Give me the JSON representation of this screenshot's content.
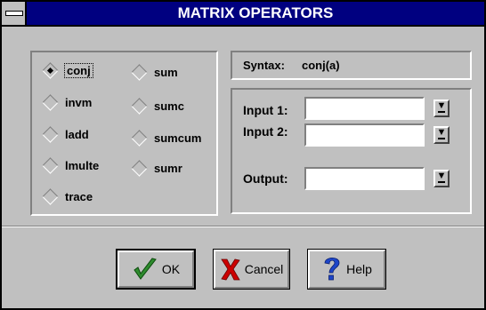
{
  "window": {
    "title": "MATRIX OPERATORS"
  },
  "functions": {
    "selected": "conj",
    "items": [
      {
        "label": "conj",
        "checked": true
      },
      {
        "label": "invm",
        "checked": false
      },
      {
        "label": "ladd",
        "checked": false
      },
      {
        "label": "lmulte",
        "checked": false
      },
      {
        "label": "trace",
        "checked": false
      },
      {
        "label": "sum",
        "checked": false
      },
      {
        "label": "sumc",
        "checked": false
      },
      {
        "label": "sumcum",
        "checked": false
      },
      {
        "label": "sumr",
        "checked": false
      }
    ]
  },
  "syntax": {
    "label": "Syntax:",
    "value": "conj(a)"
  },
  "inputs": {
    "input1_label": "Input 1:",
    "input1_value": "",
    "input2_label": "Input 2:",
    "input2_value": "",
    "output_label": "Output:",
    "output_value": ""
  },
  "buttons": {
    "ok_label": "OK",
    "cancel_label": "Cancel",
    "help_label": "Help"
  },
  "colors": {
    "title_bar": "#000080",
    "face": "#c0c0c0",
    "ok_check": "#2e8b2e",
    "cancel_x": "#cc0000",
    "help_q": "#1e46c8"
  },
  "icons": {
    "system_menu": "system-menu-icon",
    "dropdown": "dropdown-arrow-icon",
    "ok": "checkmark-icon",
    "cancel": "red-x-icon",
    "help": "question-mark-icon"
  }
}
